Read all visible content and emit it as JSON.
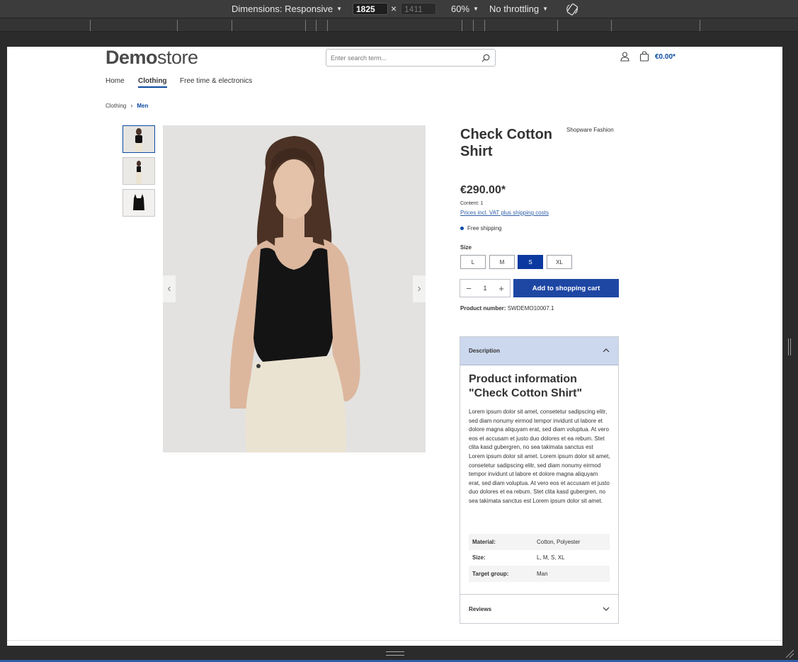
{
  "devtools": {
    "dimensions_label": "Dimensions: Responsive",
    "width_value": "1825",
    "height_value": "1411",
    "times_symbol": "×",
    "zoom": "60%",
    "throttling": "No throttling"
  },
  "header": {
    "logo_bold": "Demo",
    "logo_light": "store",
    "search_placeholder": "Enter search term...",
    "cart_total": "€0.00*"
  },
  "nav": {
    "items": [
      "Home",
      "Clothing",
      "Free time & electronics"
    ],
    "active": "Clothing"
  },
  "breadcrumb": {
    "items": [
      "Clothing",
      "Men"
    ],
    "separator": "›"
  },
  "product": {
    "title": "Check Cotton Shirt",
    "manufacturer": "Shopware Fashion",
    "price": "€290.00*",
    "content": "Content: 1",
    "vat_link": "Prices incl. VAT plus shipping costs",
    "shipping": "Free shipping",
    "size_label": "Size",
    "sizes": [
      "L",
      "M",
      "S",
      "XL"
    ],
    "selected_size": "S",
    "quantity": "1",
    "add_to_cart": "Add to shopping cart",
    "product_number_label": "Product number:",
    "product_number": "SWDEMO10007.1"
  },
  "description": {
    "header": "Description",
    "title": "Product information \"Check Cotton Shirt\"",
    "text": "Lorem ipsum dolor sit amet, consetetur sadipscing elitr, sed diam nonumy eirmod tempor invidunt ut labore et dolore magna aliquyam erat, sed diam voluptua. At vero eos et accusam et justo duo dolores et ea rebum. Stet clita kasd gubergren, no sea takimata sanctus est Lorem ipsum dolor sit amet. Lorem ipsum dolor sit amet, consetetur sadipscing elitr, sed diam nonumy eirmod tempor invidunt ut labore et dolore magna aliquyam erat, sed diam voluptua. At vero eos et accusam et justo duo dolores et ea rebum. Stet clita kasd gubergren, no sea takimata sanctus est Lorem ipsum dolor sit amet.",
    "properties": [
      {
        "key": "Material:",
        "value": "Cotton, Polyester"
      },
      {
        "key": "Size:",
        "value": "L, M, S, XL"
      },
      {
        "key": "Target group:",
        "value": "Man"
      }
    ],
    "reviews": "Reviews"
  },
  "colors": {
    "brand_blue": "#0b4aa0",
    "button_blue": "#1e47a4",
    "accordion_header": "#ccd8ee"
  }
}
